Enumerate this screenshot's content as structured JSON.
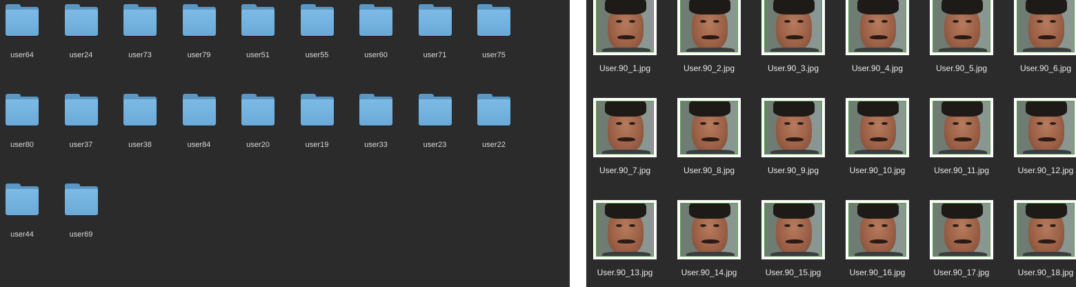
{
  "folders": [
    {
      "label": "user64"
    },
    {
      "label": "user24"
    },
    {
      "label": "user73"
    },
    {
      "label": "user79"
    },
    {
      "label": "user51"
    },
    {
      "label": "user55"
    },
    {
      "label": "user60"
    },
    {
      "label": "user71"
    },
    {
      "label": "user75"
    },
    {
      "label": "user80"
    },
    {
      "label": "user37"
    },
    {
      "label": "user38"
    },
    {
      "label": "user84"
    },
    {
      "label": "user20"
    },
    {
      "label": "user19"
    },
    {
      "label": "user33"
    },
    {
      "label": "user23"
    },
    {
      "label": "user22"
    },
    {
      "label": "user44"
    },
    {
      "label": "user69"
    }
  ],
  "images": [
    {
      "label": "User.90_1.jpg"
    },
    {
      "label": "User.90_2.jpg"
    },
    {
      "label": "User.90_3.jpg"
    },
    {
      "label": "User.90_4.jpg"
    },
    {
      "label": "User.90_5.jpg"
    },
    {
      "label": "User.90_6.jpg"
    },
    {
      "label": "User.90_7.jpg"
    },
    {
      "label": "User.90_8.jpg"
    },
    {
      "label": "User.90_9.jpg"
    },
    {
      "label": "User.90_10.jpg"
    },
    {
      "label": "User.90_11.jpg"
    },
    {
      "label": "User.90_12.jpg"
    },
    {
      "label": "User.90_13.jpg"
    },
    {
      "label": "User.90_14.jpg"
    },
    {
      "label": "User.90_15.jpg"
    },
    {
      "label": "User.90_16.jpg"
    },
    {
      "label": "User.90_17.jpg"
    },
    {
      "label": "User.90_18.jpg"
    }
  ],
  "icons": {
    "folder": "folder-icon",
    "image": "image-thumbnail"
  },
  "colors": {
    "background": "#2c2b2b",
    "folder": "#6aa9d8",
    "thumb_border": "#ffffff",
    "label": "#e6e6e6"
  }
}
